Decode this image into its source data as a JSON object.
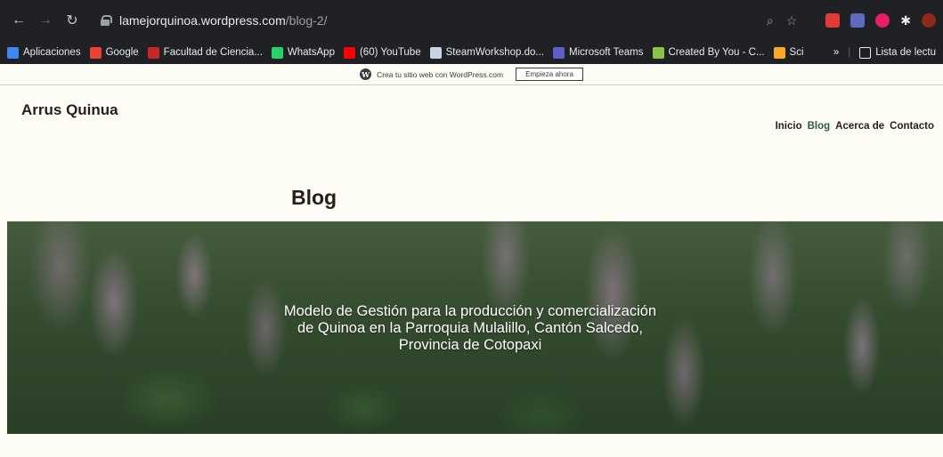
{
  "browser": {
    "url_host": "lamejorquinoa.wordpress.com",
    "url_path": "/blog-2/",
    "bookmarks": [
      {
        "label": "Aplicaciones",
        "color": "#4285f4"
      },
      {
        "label": "Google",
        "color": "#ea4335"
      },
      {
        "label": "Facultad de Ciencia...",
        "color": "#c62828"
      },
      {
        "label": "WhatsApp",
        "color": "#25d366"
      },
      {
        "label": "(60) YouTube",
        "color": "#ff0000"
      },
      {
        "label": "SteamWorkshop.do...",
        "color": "#c7d5e0"
      },
      {
        "label": "Microsoft Teams",
        "color": "#5b5fc7"
      },
      {
        "label": "Created By You - C...",
        "color": "#8bc34a"
      },
      {
        "label": "Sci",
        "color": "#f9a825"
      }
    ],
    "overflow": "»",
    "reading_list": "Lista de lectu"
  },
  "wp_banner": {
    "text": "Crea tu sitio web con WordPress.com",
    "cta": "Empieza ahora"
  },
  "site": {
    "title": "Arrus Quinua",
    "nav": [
      "Inicio",
      "Blog",
      "Acerca de",
      "Contacto"
    ],
    "active_nav": "Blog",
    "page_title": "Blog"
  },
  "hero": {
    "text": "Modelo de Gestión para la producción y comercialización de Quinoa en la Parroquia Mulalillo, Cantón Salcedo, Provincia de Cotopaxi"
  }
}
